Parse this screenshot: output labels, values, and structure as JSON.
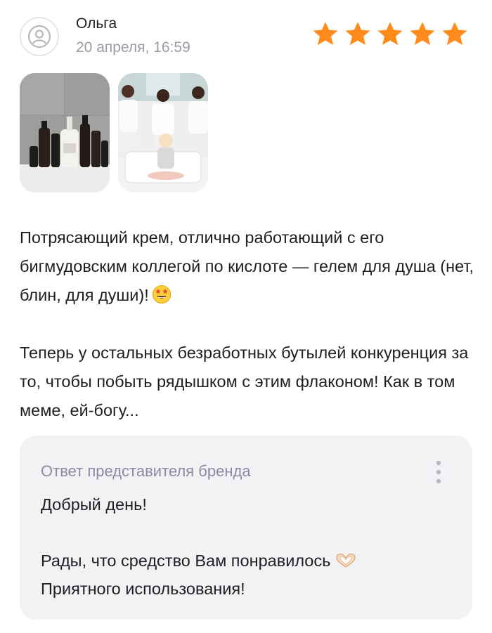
{
  "review": {
    "author_name": "Ольга",
    "date": "20 апреля, 16:59",
    "rating": 5,
    "rating_max": 5,
    "star_color": "#ff8c1a",
    "photos": [
      {
        "icon": "cosmetic-bottles-photo"
      },
      {
        "icon": "meme-photo"
      }
    ],
    "paragraph_1": "Потрясающий крем, отлично работающий с его бигмудовским коллегой по кислоте — гелем для душа (нет, блин, для души)!",
    "paragraph_1_emoji": "star-struck-emoji",
    "paragraph_2": "Теперь у остальных безработных бутылей конкуренция за то, чтобы побыть рядышком с этим флаконом! Как в том меме, ей-богу..."
  },
  "brand_reply": {
    "title": "Ответ представителя бренда",
    "line_1": "Добрый день!",
    "line_2": "Рады, что средство Вам понравилось",
    "line_2_emoji": "heart-hands-emoji",
    "line_3": "Приятного использования!",
    "menu_icon": "more-vertical-icon"
  },
  "colors": {
    "reply_background": "#f2f2f5",
    "reply_title": "#8c8aa3",
    "secondary_text": "#9a9aa4"
  }
}
